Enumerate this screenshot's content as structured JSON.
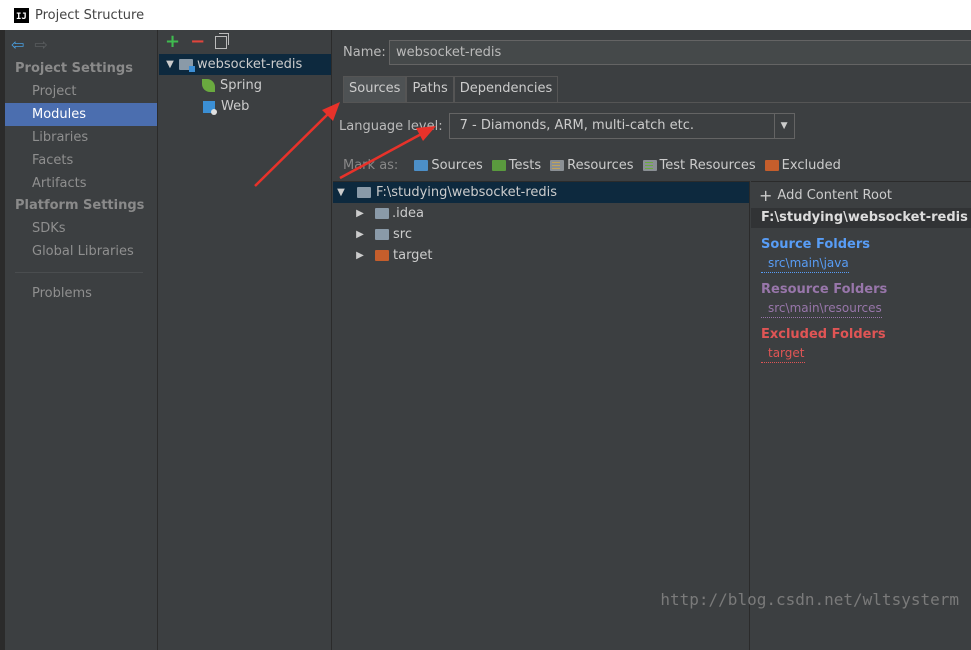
{
  "window": {
    "title": "Project Structure",
    "logo": "IJ"
  },
  "sidebar": {
    "sections": [
      {
        "title": "Project Settings",
        "items": [
          "Project",
          "Modules",
          "Libraries",
          "Facets",
          "Artifacts"
        ]
      },
      {
        "title": "Platform Settings",
        "items": [
          "SDKs",
          "Global Libraries"
        ]
      }
    ],
    "selected": "Modules",
    "problems": "Problems"
  },
  "modules": {
    "root": "websocket-redis",
    "children": [
      "Spring",
      "Web"
    ]
  },
  "main": {
    "name_label": "Name:",
    "name_value": "websocket-redis",
    "tabs": [
      "Sources",
      "Paths",
      "Dependencies"
    ],
    "active_tab": "Sources",
    "language_label": "Language level:",
    "language_value": "7 - Diamonds, ARM, multi-catch etc.",
    "mark_as_label": "Mark as:",
    "mark_buttons": [
      "Sources",
      "Tests",
      "Resources",
      "Test Resources",
      "Excluded"
    ],
    "tree_root": "F:\\studying\\websocket-redis",
    "tree_children": [
      ".idea",
      "src",
      "target"
    ]
  },
  "roots": {
    "add_label": "Add Content Root",
    "path": "F:\\studying\\websocket-redis",
    "source_title": "Source Folders",
    "source_item": "src\\main\\java",
    "resource_title": "Resource Folders",
    "resource_item": "src\\main\\resources",
    "excluded_title": "Excluded Folders",
    "excluded_item": "target"
  },
  "watermark": "http://blog.csdn.net/wltsysterm",
  "colors": {
    "selection": "#4b6eaf",
    "tree_selection": "#0d293e",
    "annotation_arrow": "#e8322a"
  }
}
